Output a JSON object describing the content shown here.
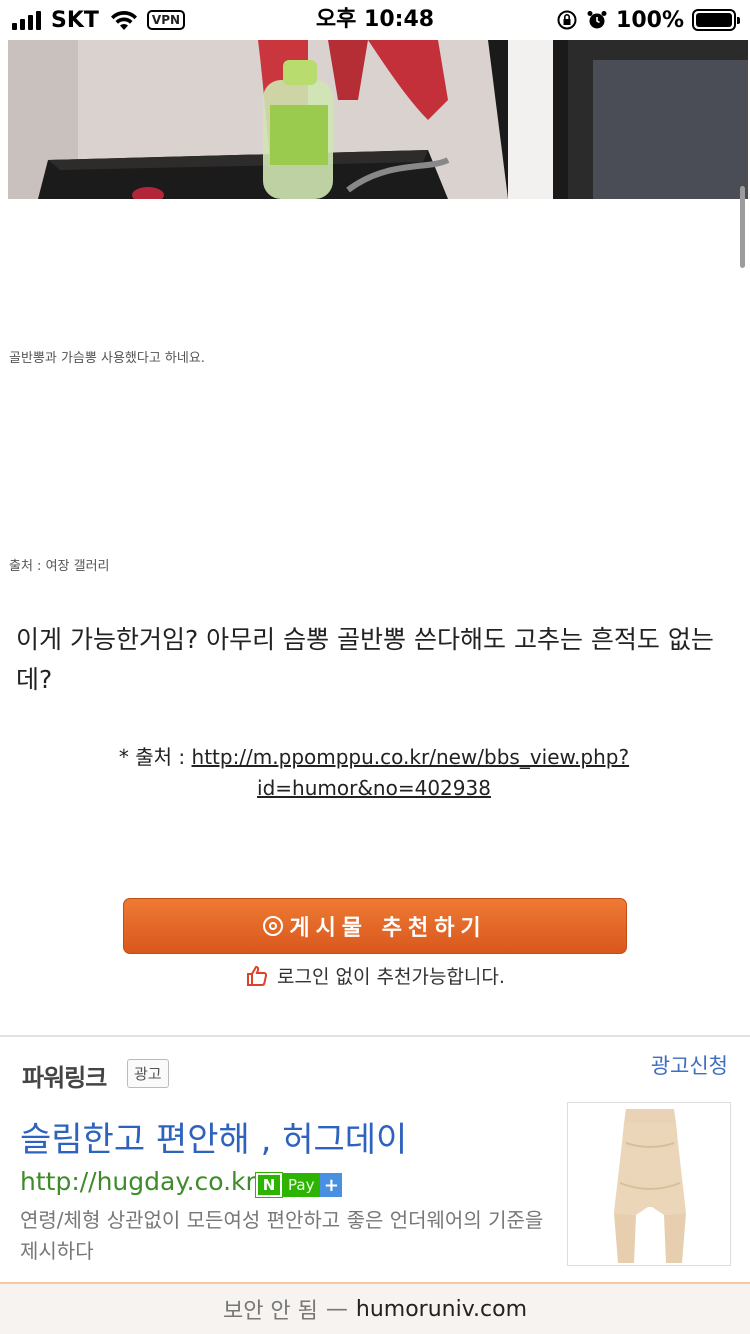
{
  "status_bar": {
    "carrier": "SKT",
    "vpn": "VPN",
    "time": "오후 10:48",
    "battery": "100%",
    "battery_level": 1.0,
    "icons": [
      "signal-icon",
      "wifi-icon",
      "vpn-icon",
      "orientation-lock-icon",
      "alarm-icon",
      "battery-icon"
    ]
  },
  "article": {
    "caption_1": "골반뽕과 가슴뽕 사용했다고 하네요.",
    "caption_2": "출처 : 여장 갤러리",
    "body": "이게 가능한거임?  아무리 슴뽕 골반뽕 쓴다해도 고추는 흔적도 없는데?",
    "source_prefix": "* 출처 : ",
    "source_link": "http://m.ppomppu.co.kr/new/bbs_view.php?id=humor&no=402938"
  },
  "recommend": {
    "button_label": "게시물 추천하기",
    "note": "로그인 없이 추천가능합니다."
  },
  "ad": {
    "section_title": "파워링크",
    "badge": "광고",
    "apply_link": "광고신청",
    "headline": "슬림한고 편안해 , 허그데이",
    "url": "http://hugday.co.kr",
    "npay_n": "N",
    "npay_pay": "Pay",
    "npay_plus": "+",
    "description": "연령/체형 상관없이 모든여성 편안하고 좋은 언더웨어의 기준을 제시하다"
  },
  "browser": {
    "insecure_label": "보안 안 됨",
    "separator": "—",
    "domain": "humoruniv.com"
  }
}
